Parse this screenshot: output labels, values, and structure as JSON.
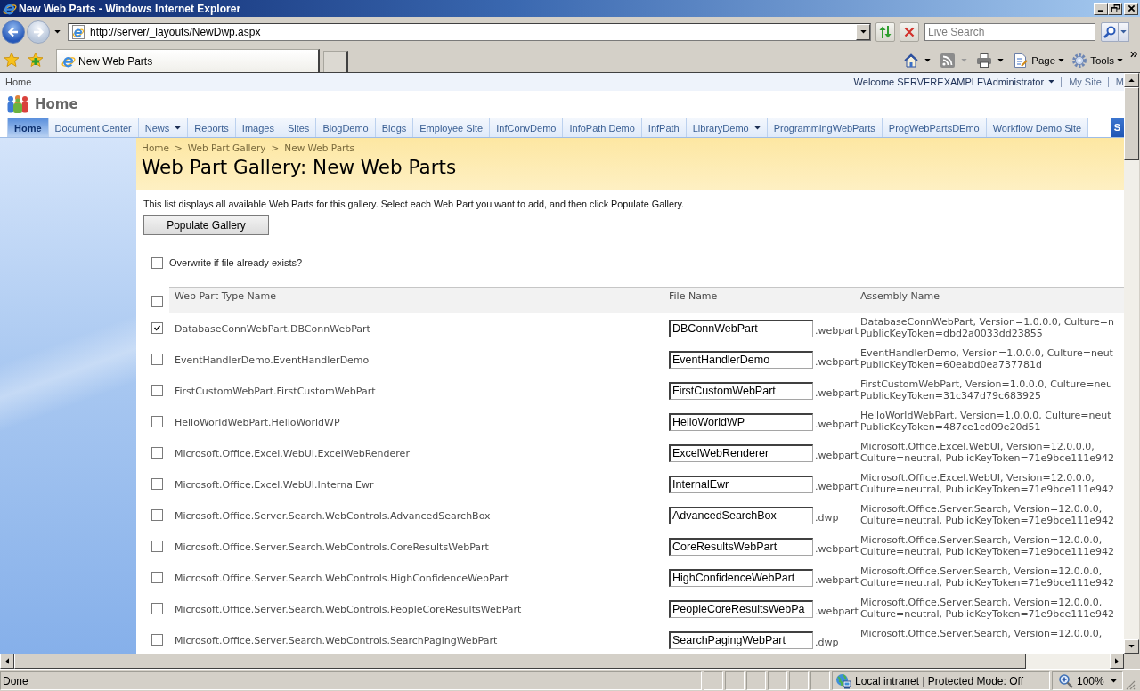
{
  "window": {
    "title": "New Web Parts - Windows Internet Explorer"
  },
  "address_bar": {
    "url": "http://server/_layouts/NewDwp.aspx"
  },
  "search": {
    "placeholder": "Live Search"
  },
  "tabs": [
    {
      "label": "New Web Parts",
      "selected": true
    }
  ],
  "command_bar": {
    "page": "Page",
    "tools": "Tools"
  },
  "site": {
    "top_link": "Home",
    "welcome": "Welcome SERVEREXAMPLE\\Administrator",
    "links": [
      "My Site",
      "M"
    ],
    "title": "Home",
    "nav": [
      {
        "label": "Home",
        "selected": true,
        "menu": false
      },
      {
        "label": "Document Center",
        "selected": false,
        "menu": false
      },
      {
        "label": "News",
        "selected": false,
        "menu": true
      },
      {
        "label": "Reports",
        "selected": false,
        "menu": false
      },
      {
        "label": "Images",
        "selected": false,
        "menu": false
      },
      {
        "label": "Sites",
        "selected": false,
        "menu": false
      },
      {
        "label": "BlogDemo",
        "selected": false,
        "menu": false
      },
      {
        "label": "Blogs",
        "selected": false,
        "menu": false
      },
      {
        "label": "Employee Site",
        "selected": false,
        "menu": false
      },
      {
        "label": "InfConvDemo",
        "selected": false,
        "menu": false
      },
      {
        "label": "InfoPath Demo",
        "selected": false,
        "menu": false
      },
      {
        "label": "InfPath",
        "selected": false,
        "menu": false
      },
      {
        "label": "LibraryDemo",
        "selected": false,
        "menu": true
      },
      {
        "label": "ProgrammingWebParts",
        "selected": false,
        "menu": false
      },
      {
        "label": "ProgWebPartsDEmo",
        "selected": false,
        "menu": false
      },
      {
        "label": "Workflow Demo Site",
        "selected": false,
        "menu": false
      }
    ],
    "site_actions": "S"
  },
  "page": {
    "breadcrumb": [
      {
        "label": "Home",
        "separator": ">"
      },
      {
        "label": "Web Part Gallery",
        "separator": ">"
      },
      {
        "label": "New Web Parts"
      }
    ],
    "title": "Web Part Gallery: New Web Parts",
    "description": "This list displays all available Web Parts for this gallery. Select each Web Part you want to add, and then click Populate Gallery.",
    "populate_button": "Populate Gallery",
    "overwrite": {
      "label": "Overwrite if file already exists?",
      "checked": false
    }
  },
  "table": {
    "select_all_checked": false,
    "columns": [
      "Web Part Type Name",
      "File Name",
      "Assembly Name"
    ],
    "rows": [
      {
        "checked": true,
        "type_name": "DatabaseConnWebPart.DBConnWebPart",
        "file_name": "DBConnWebPart",
        "extension": ".webpart",
        "assembly": [
          "DatabaseConnWebPart, Version=1.0.0.0, Culture=n",
          "PublicKeyToken=dbd2a0033dd23855"
        ]
      },
      {
        "checked": false,
        "type_name": "EventHandlerDemo.EventHandlerDemo",
        "file_name": "EventHandlerDemo",
        "extension": ".webpart",
        "assembly": [
          "EventHandlerDemo, Version=1.0.0.0, Culture=neut",
          "PublicKeyToken=60eabd0ea737781d"
        ]
      },
      {
        "checked": false,
        "type_name": "FirstCustomWebPart.FirstCustomWebPart",
        "file_name": "FirstCustomWebPart",
        "extension": ".webpart",
        "assembly": [
          "FirstCustomWebPart, Version=1.0.0.0, Culture=neu",
          "PublicKeyToken=31c347d79c683925"
        ]
      },
      {
        "checked": false,
        "type_name": "HelloWorldWebPart.HelloWorldWP",
        "file_name": "HelloWorldWP",
        "extension": ".webpart",
        "assembly": [
          "HelloWorldWebPart, Version=1.0.0.0, Culture=neut",
          "PublicKeyToken=487ce1cd09e20d51"
        ]
      },
      {
        "checked": false,
        "type_name": "Microsoft.Office.Excel.WebUI.ExcelWebRenderer",
        "file_name": "ExcelWebRenderer",
        "extension": ".webpart",
        "assembly": [
          "Microsoft.Office.Excel.WebUI, Version=12.0.0.0,",
          "Culture=neutral, PublicKeyToken=71e9bce111e942"
        ]
      },
      {
        "checked": false,
        "type_name": "Microsoft.Office.Excel.WebUI.InternalEwr",
        "file_name": "InternalEwr",
        "extension": ".webpart",
        "assembly": [
          "Microsoft.Office.Excel.WebUI, Version=12.0.0.0,",
          "Culture=neutral, PublicKeyToken=71e9bce111e942"
        ]
      },
      {
        "checked": false,
        "type_name": "Microsoft.Office.Server.Search.WebControls.AdvancedSearchBox",
        "file_name": "AdvancedSearchBox",
        "extension": ".dwp",
        "assembly": [
          "Microsoft.Office.Server.Search, Version=12.0.0.0,",
          "Culture=neutral, PublicKeyToken=71e9bce111e942"
        ]
      },
      {
        "checked": false,
        "type_name": "Microsoft.Office.Server.Search.WebControls.CoreResultsWebPart",
        "file_name": "CoreResultsWebPart",
        "extension": ".webpart",
        "assembly": [
          "Microsoft.Office.Server.Search, Version=12.0.0.0,",
          "Culture=neutral, PublicKeyToken=71e9bce111e942"
        ]
      },
      {
        "checked": false,
        "type_name": "Microsoft.Office.Server.Search.WebControls.HighConfidenceWebPart",
        "file_name": "HighConfidenceWebPart",
        "extension": ".webpart",
        "assembly": [
          "Microsoft.Office.Server.Search, Version=12.0.0.0,",
          "Culture=neutral, PublicKeyToken=71e9bce111e942"
        ]
      },
      {
        "checked": false,
        "type_name": "Microsoft.Office.Server.Search.WebControls.PeopleCoreResultsWebPart",
        "file_name": "PeopleCoreResultsWebPa",
        "extension": ".webpart",
        "assembly": [
          "Microsoft.Office.Server.Search, Version=12.0.0.0,",
          "Culture=neutral, PublicKeyToken=71e9bce111e942"
        ]
      },
      {
        "checked": false,
        "type_name": "Microsoft.Office.Server.Search.WebControls.SearchPagingWebPart",
        "file_name": "SearchPagingWebPart",
        "extension": ".dwp",
        "assembly": [
          "Microsoft.Office.Server.Search, Version=12.0.0.0,"
        ]
      }
    ]
  },
  "status_bar": {
    "text": "Done",
    "zone": "Local intranet | Protected Mode: Off",
    "zoom": "100%"
  }
}
